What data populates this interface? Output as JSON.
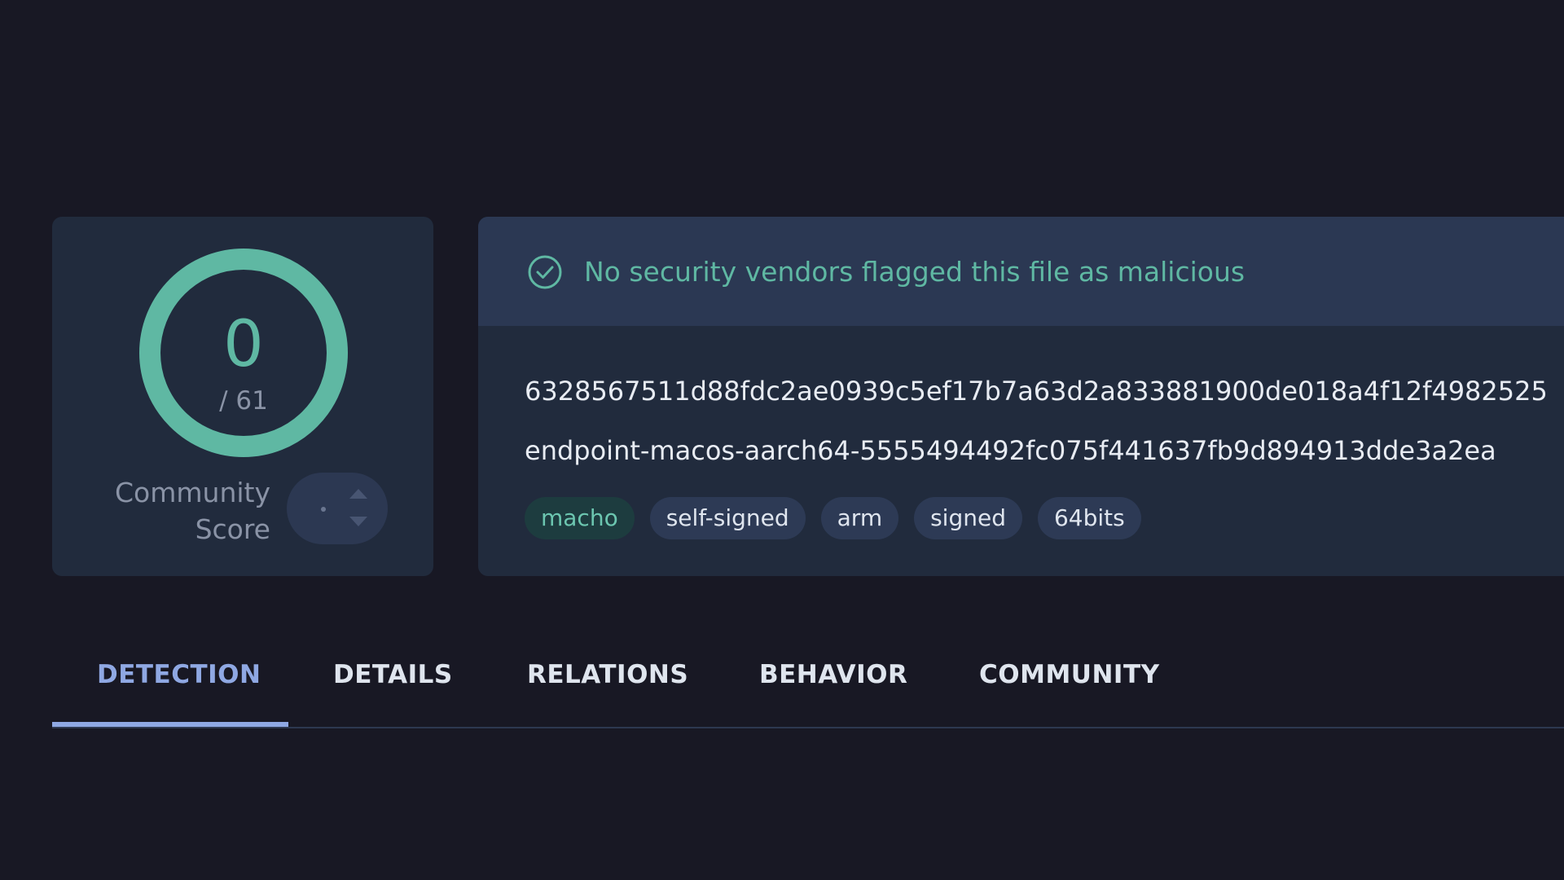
{
  "score": {
    "detections": "0",
    "total": "/ 61",
    "community_label": "Community Score",
    "ring_color": "#5fb8a3"
  },
  "banner": {
    "icon": "check-circle-icon",
    "message": "No security vendors flagged this file as malicious"
  },
  "file": {
    "hash": "6328567511d88fdc2ae0939c5ef17b7a63d2a833881900de018a4f12f4982525",
    "name": "endpoint-macos-aarch64-5555494492fc075f441637fb9d894913dde3a2ea"
  },
  "tags": [
    "macho",
    "self-signed",
    "arm",
    "signed",
    "64bits"
  ],
  "tabs": [
    "DETECTION",
    "DETAILS",
    "RELATIONS",
    "BEHAVIOR",
    "COMMUNITY"
  ],
  "active_tab": "DETECTION",
  "colors": {
    "background": "#181824",
    "card": "#212b3d",
    "accent_green": "#5fb8a3",
    "accent_blue": "#8fa8e3"
  }
}
